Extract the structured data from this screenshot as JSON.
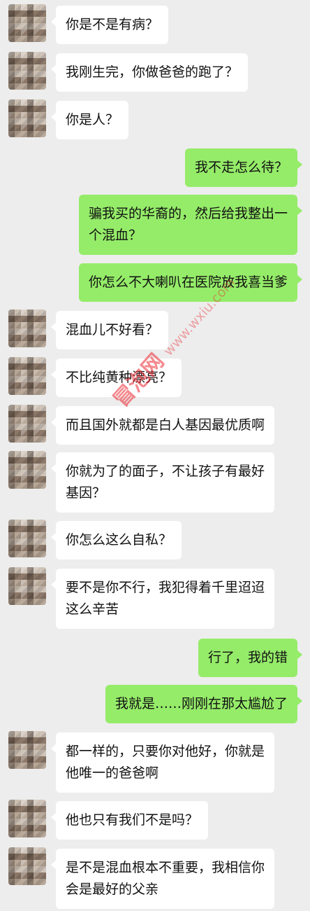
{
  "colors": {
    "background": "#ededed",
    "incoming_bubble": "#ffffff",
    "outgoing_bubble": "#95ec69",
    "watermark": "#eb2832"
  },
  "watermark": {
    "brand": "冒泡网",
    "site": "www.wxiu.com"
  },
  "messages": [
    {
      "side": "in",
      "text": "你是不是有病？"
    },
    {
      "side": "in",
      "text": "我刚生完，你做爸爸的跑了？"
    },
    {
      "side": "in",
      "text": "你是人？"
    },
    {
      "side": "out",
      "text": "我不走怎么待？"
    },
    {
      "side": "out",
      "text": "骗我买的华裔的，然后给我整出一\n个混血？"
    },
    {
      "side": "out",
      "text": "你怎么不大喇叭在医院放我喜当爹"
    },
    {
      "side": "in",
      "text": "混血儿不好看？"
    },
    {
      "side": "in",
      "text": "不比纯黄种漂亮？"
    },
    {
      "side": "in",
      "text": "而且国外就都是白人基因最优质啊"
    },
    {
      "side": "in",
      "text": "你就为了的面子，不让孩子有最好\n基因？"
    },
    {
      "side": "in",
      "text": "你怎么这么自私？"
    },
    {
      "side": "in",
      "text": "要不是你不行，我犯得着千里迢迢\n这么辛苦"
    },
    {
      "side": "out",
      "text": "行了，我的错"
    },
    {
      "side": "out",
      "text": "我就是……刚刚在那太尴尬了"
    },
    {
      "side": "in",
      "text": "都一样的，只要你对他好，你就是\n他唯一的爸爸啊"
    },
    {
      "side": "in",
      "text": "他也只有我们不是吗？"
    },
    {
      "side": "in",
      "text": "是不是混血根本不重要，我相信你\n会是最好的父亲"
    }
  ]
}
